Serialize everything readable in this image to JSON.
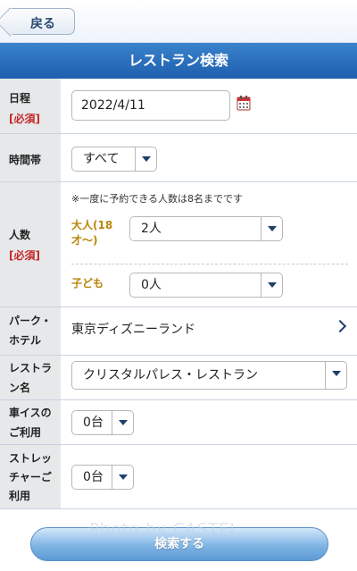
{
  "header": {
    "back_label": "戻る",
    "title": "レストラン検索"
  },
  "date_row": {
    "label": "日程",
    "required": "[必須]",
    "value": "2022/4/11",
    "icon": "calendar-icon"
  },
  "time_row": {
    "label": "時間帯",
    "selected": "すべて"
  },
  "people_row": {
    "label": "人数",
    "required": "[必須]",
    "note": "※一度に予約できる人数は8名までです",
    "adult_label": "大人(18才〜)",
    "adult_selected": "2人",
    "child_label": "子ども",
    "child_selected": "0人"
  },
  "park_row": {
    "label": "パーク・ホテル",
    "value": "東京ディズニーランド"
  },
  "restaurant_row": {
    "label": "レストラン名",
    "selected": "クリスタルパレス・レストラン"
  },
  "wheelchair_row": {
    "label": "車イスのご利用",
    "selected": "0台"
  },
  "stretcher_row": {
    "label": "ストレッチャーご利用",
    "selected": "0台"
  },
  "footer": {
    "search_label": "検索する",
    "watermark": "Photo by CASTEL"
  },
  "colors": {
    "title_blue": "#1e5fae",
    "required_red": "#c62828",
    "sub_label_gold": "#b8860b"
  }
}
